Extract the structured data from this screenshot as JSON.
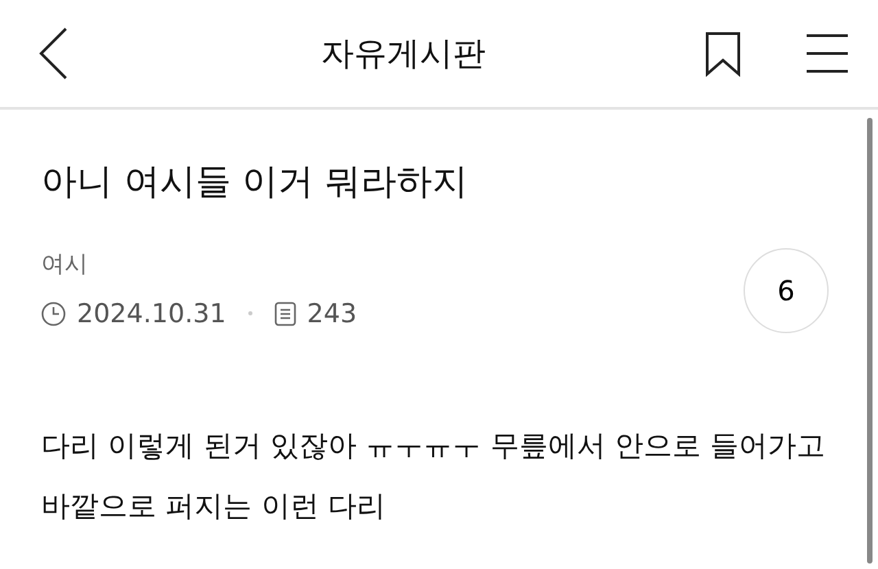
{
  "header": {
    "title": "자유게시판"
  },
  "post": {
    "title": "아니 여시들 이거 뭐라하지",
    "author": "여시",
    "date": "2024.10.31",
    "views": "243",
    "comment_count": "6",
    "body": "다리 이렇게 된거 있잖아 ㅠㅜㅠㅜ 무릎에서 안으로 들어가고 바깥으로 퍼지는 이런 다리"
  }
}
